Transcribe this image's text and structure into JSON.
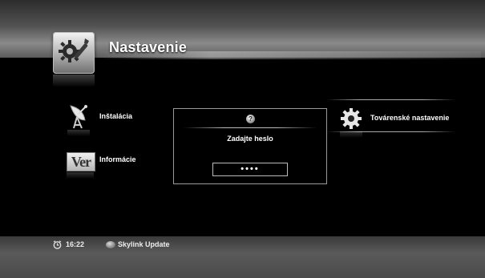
{
  "header": {
    "title": "Nastavenie",
    "icon": "settings-wrench-gear-icon"
  },
  "menu": {
    "items": [
      {
        "label": "Inštalácia",
        "icon": "satellite-dish-icon"
      },
      {
        "label": "Informácie",
        "icon": "version-icon",
        "icon_text": "Ver"
      },
      {
        "label": "Továrenské nastavenie",
        "icon": "gear-icon"
      }
    ]
  },
  "dialog": {
    "icon": "question-icon",
    "icon_glyph": "?",
    "prompt": "Zadajte heslo",
    "password_value": "••••"
  },
  "statusbar": {
    "clock_icon": "clock-icon",
    "time": "16:22",
    "update_icon": "disc-icon",
    "update_label": "Skylink Update"
  },
  "colors": {
    "background": "#000000",
    "header_band": "#8a8a8a",
    "text": "#ffffff",
    "bottombar": "#4a4a4a"
  }
}
